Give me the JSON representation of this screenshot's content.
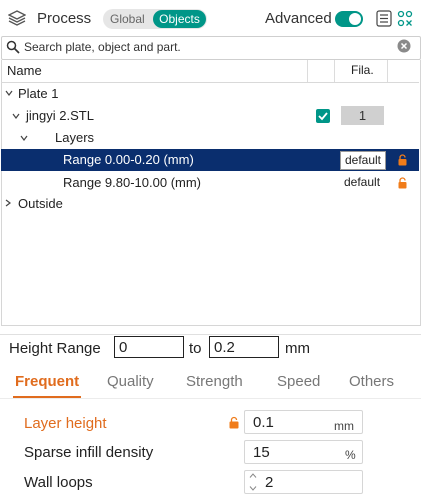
{
  "header": {
    "title": "Process",
    "segments": [
      "Global",
      "Objects"
    ],
    "advanced_label": "Advanced",
    "advanced_on": true,
    "icons": [
      "layers-icon",
      "list-icon",
      "grid-settings-icon"
    ],
    "accent_color": "#009688"
  },
  "search": {
    "placeholder": "Search plate, object and part."
  },
  "tree": {
    "columns": {
      "name": "Name",
      "fila": "Fila."
    },
    "rows": [
      {
        "label": "Plate 1",
        "level": 0,
        "expanded": true
      },
      {
        "label": "jingyi 2.STL",
        "level": 1,
        "expanded": true,
        "checked": true,
        "filament": "1"
      },
      {
        "label": "Layers",
        "level": 2,
        "expanded": true
      },
      {
        "label": "Range 0.00-0.20 (mm)",
        "level": 3,
        "badge": "default",
        "selected": true
      },
      {
        "label": "Range 9.80-10.00 (mm)",
        "level": 3,
        "badge": "default"
      },
      {
        "label": "Outside",
        "level": 0,
        "expanded": false
      }
    ],
    "selection_color": "#0a2e6e"
  },
  "height_range": {
    "label": "Height Range",
    "from": "0",
    "to_label": "to",
    "to": "0.2",
    "unit": "mm"
  },
  "tabs": [
    {
      "label": "Frequent",
      "active": true
    },
    {
      "label": "Quality"
    },
    {
      "label": "Strength"
    },
    {
      "label": "Speed"
    },
    {
      "label": "Others"
    }
  ],
  "params": [
    {
      "label": "Layer height",
      "value": "0.1",
      "unit": "mm",
      "modified": true
    },
    {
      "label": "Sparse infill density",
      "value": "15",
      "unit": "%"
    },
    {
      "label": "Wall loops",
      "value": "2"
    }
  ],
  "highlight_color": "#e06c1e"
}
